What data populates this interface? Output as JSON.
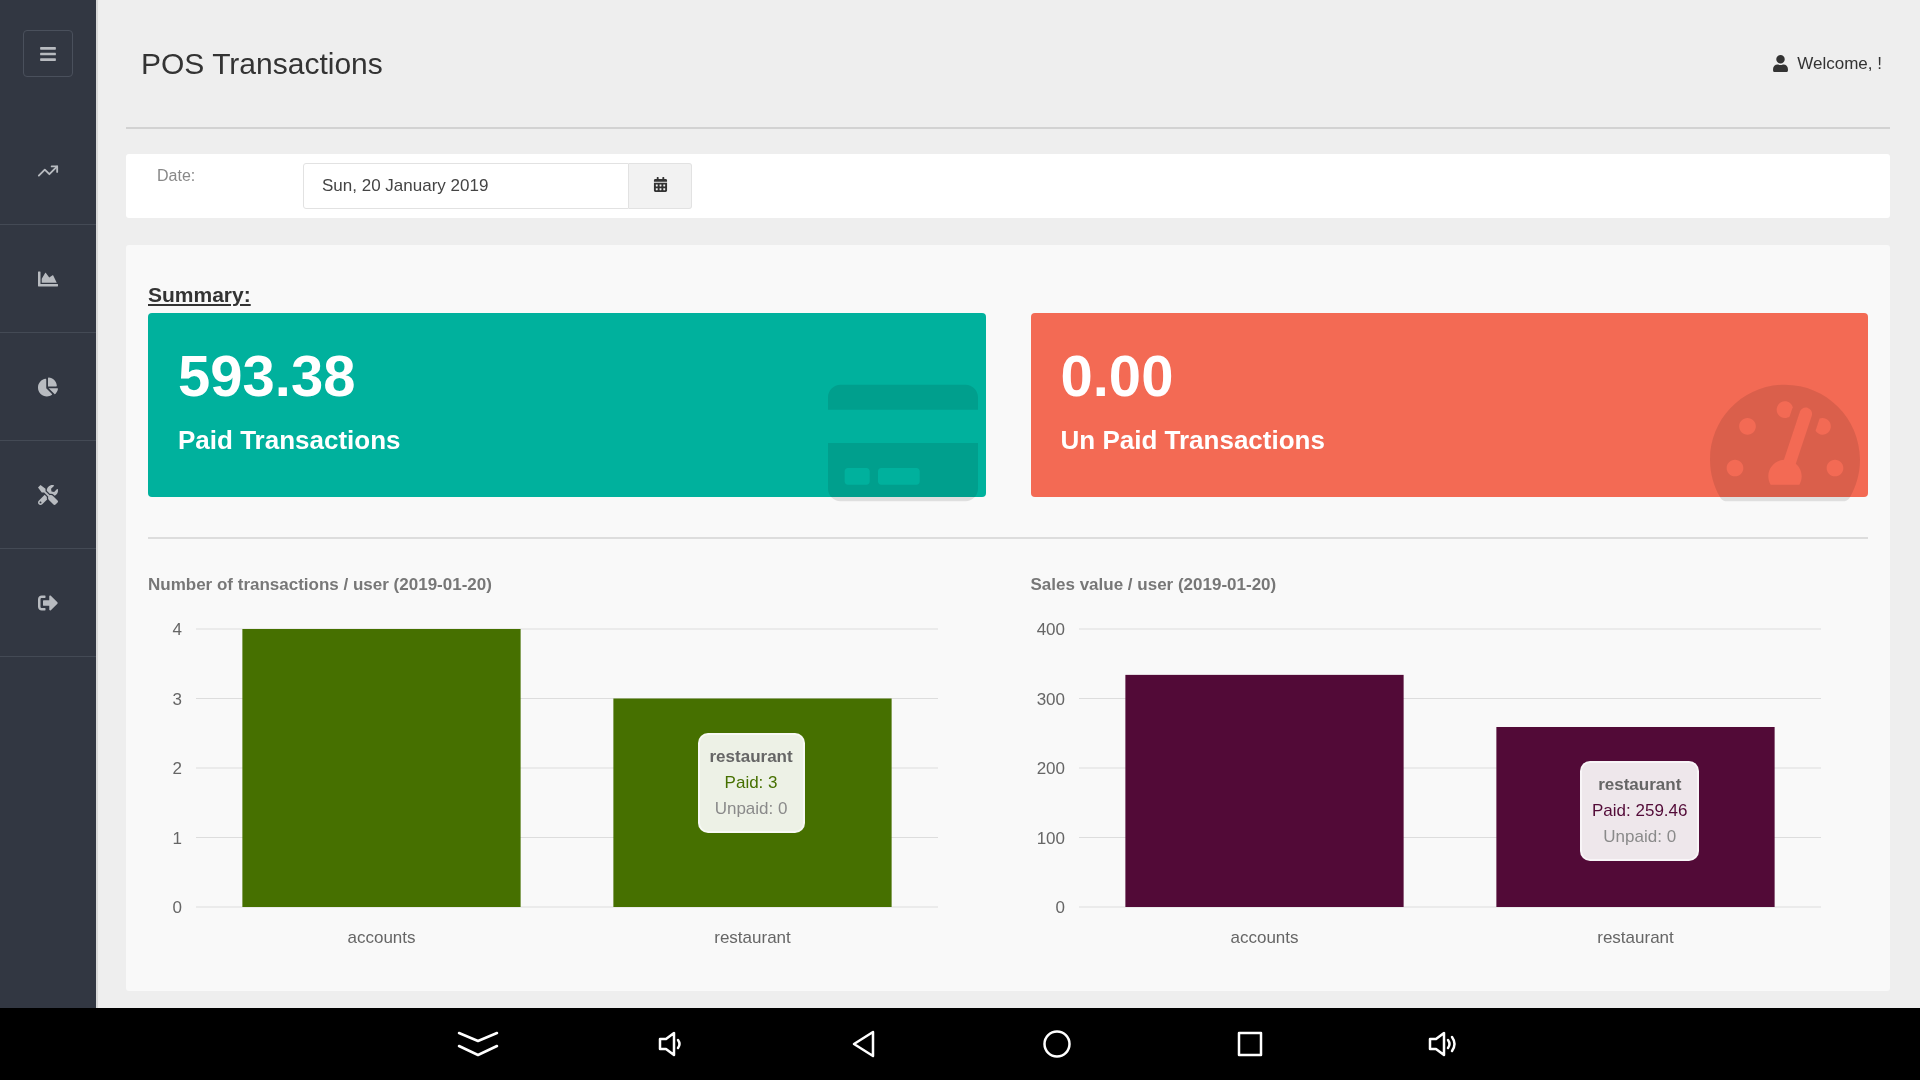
{
  "header": {
    "title": "POS Transactions",
    "welcome": "Welcome, !"
  },
  "date_filter": {
    "label": "Date:",
    "value": "Sun, 20 January 2019"
  },
  "summary": {
    "title": "Summary:",
    "cards": [
      {
        "kind": "paid",
        "value": "593.38",
        "label": "Paid Transactions"
      },
      {
        "kind": "unpaid",
        "value": "0.00",
        "label": "Un Paid Transactions"
      }
    ]
  },
  "charts": [
    {
      "tooltip": {
        "category": "restaurant",
        "paid": "Paid: 3",
        "unpaid": "Unpaid: 0"
      },
      "chart_data": {
        "type": "bar",
        "title": "Number of transactions / user (2019-01-20)",
        "categories": [
          "accounts",
          "restaurant"
        ],
        "series": [
          {
            "color": "#467000",
            "values": [
              4,
              3
            ]
          }
        ],
        "ylim": [
          0,
          4
        ],
        "yticks": [
          0,
          1,
          2,
          3,
          4
        ],
        "grid": true
      }
    },
    {
      "tooltip": {
        "category": "restaurant",
        "paid": "Paid: 259.46",
        "unpaid": "Unpaid: 0"
      },
      "chart_data": {
        "type": "bar",
        "title": "Sales value / user (2019-01-20)",
        "categories": [
          "accounts",
          "restaurant"
        ],
        "series": [
          {
            "color": "#520a37",
            "values": [
              334,
              259
            ]
          }
        ],
        "ylim": [
          0,
          400
        ],
        "yticks": [
          0,
          100,
          200,
          300,
          400
        ],
        "grid": true
      }
    }
  ]
}
